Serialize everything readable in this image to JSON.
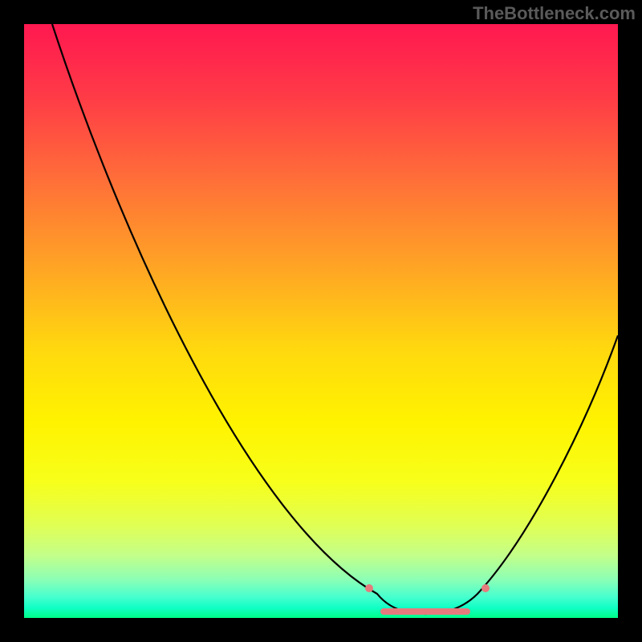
{
  "watermark": "TheBottleneck.com",
  "chart_data": {
    "type": "line",
    "title": "",
    "xlabel": "",
    "ylabel": "",
    "xlim": [
      0,
      100
    ],
    "ylim": [
      0,
      100
    ],
    "background": {
      "type": "vertical_gradient",
      "stops": [
        {
          "pos": 0.0,
          "color": "#ff1850"
        },
        {
          "pos": 0.25,
          "color": "#ff6a3a"
        },
        {
          "pos": 0.55,
          "color": "#ffd90e"
        },
        {
          "pos": 0.8,
          "color": "#e8ff48"
        },
        {
          "pos": 0.95,
          "color": "#55ffc0"
        },
        {
          "pos": 1.0,
          "color": "#00ff88"
        }
      ],
      "meaning": "top = worst, bottom = best"
    },
    "series": [
      {
        "name": "bottleneck_curve",
        "color": "#000000",
        "x": [
          5,
          10,
          20,
          30,
          40,
          50,
          55,
          60,
          63,
          66,
          68,
          72,
          76,
          80,
          85,
          90,
          95,
          100
        ],
        "y": [
          100,
          90,
          73,
          56,
          40,
          24,
          16,
          9,
          5,
          2,
          1,
          1,
          2,
          5,
          13,
          25,
          38,
          48
        ]
      }
    ],
    "annotations": [
      {
        "name": "optimal_band",
        "type": "highlight",
        "color": "#e67b7d",
        "x_range": [
          58,
          78
        ],
        "y": 1,
        "note": "emphasized flat bottom region of curve"
      }
    ],
    "grid": false,
    "legend": false
  }
}
